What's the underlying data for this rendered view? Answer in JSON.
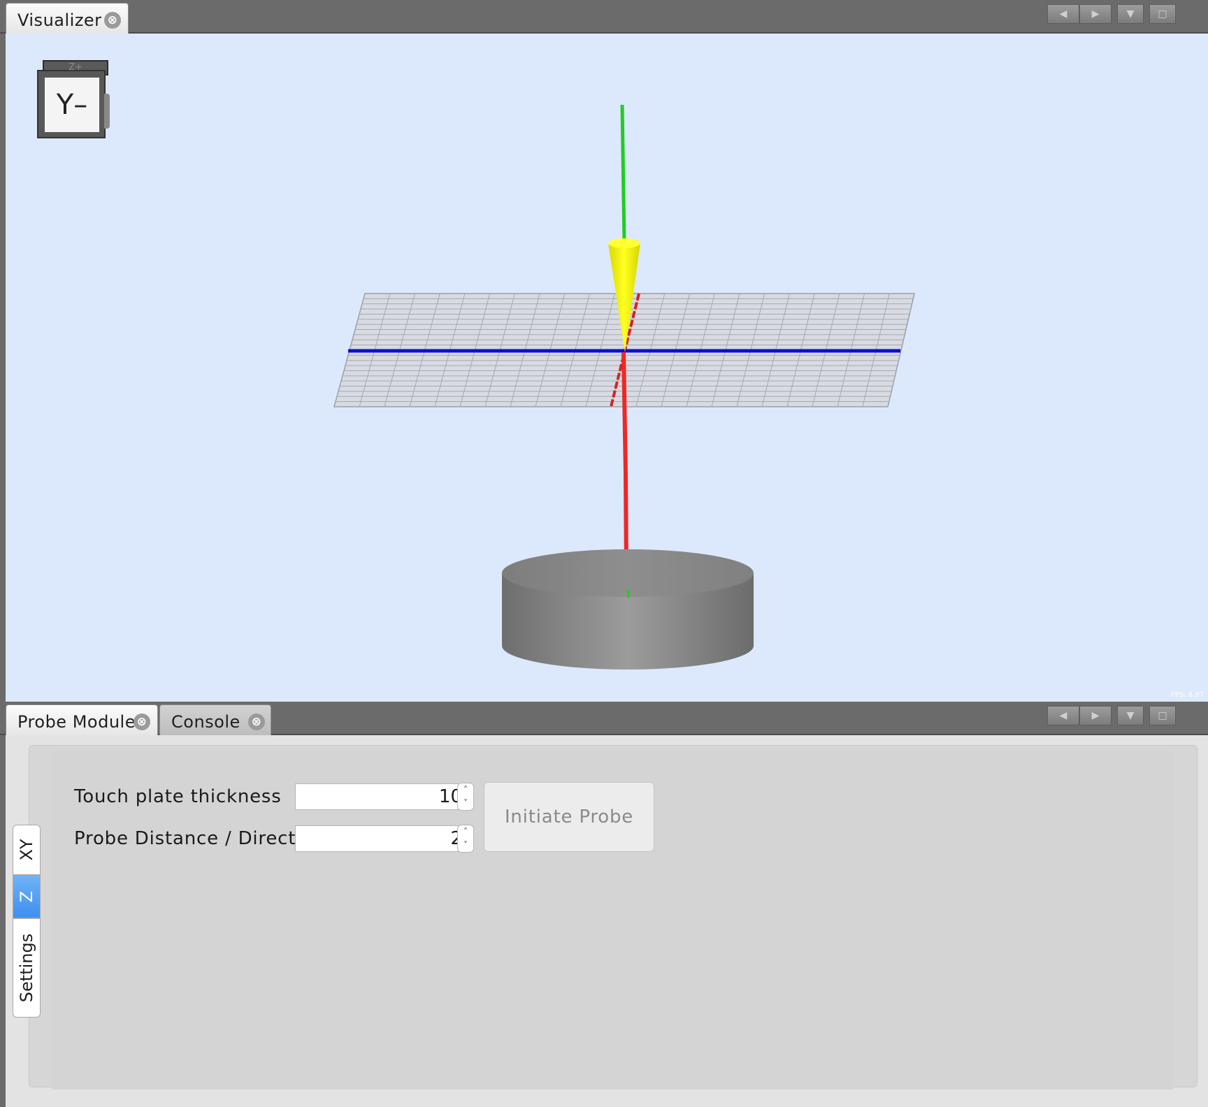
{
  "top_panel": {
    "tab_label": "Visualizer",
    "close_glyph": "⊗",
    "prev_glyph": "◀",
    "next_glyph": "▶",
    "menu_glyph": "▼",
    "maximize_glyph": "□"
  },
  "visualizer": {
    "view_cube": {
      "face_label": "Y–",
      "top_label": "Z+"
    },
    "fps_text": "FPS: 8.87",
    "colors": {
      "background": "#dce9fc",
      "y_axis": "#22cc22",
      "x_axis": "#0000cc",
      "z_axis": "#ee2222",
      "tool": "#ffff00",
      "plate": "#999999"
    }
  },
  "bottom_panel": {
    "tabs": [
      {
        "label": "Probe Module",
        "active": true
      },
      {
        "label": "Console",
        "active": false
      }
    ],
    "close_glyph": "⊗",
    "prev_glyph": "◀",
    "next_glyph": "▶",
    "menu_glyph": "▼",
    "maximize_glyph": "□"
  },
  "probe_module": {
    "side_tabs": [
      {
        "label": "XY",
        "selected": false
      },
      {
        "label": "Z",
        "selected": true
      },
      {
        "label": "Settings",
        "selected": false
      }
    ],
    "touch_plate_label": "Touch plate thickness",
    "touch_plate_value": "10",
    "probe_distance_label": "Probe Distance / Direction",
    "probe_distance_value": "2",
    "spinner_up": "˄",
    "spinner_down": "˅",
    "initiate_button": "Initiate Probe"
  }
}
